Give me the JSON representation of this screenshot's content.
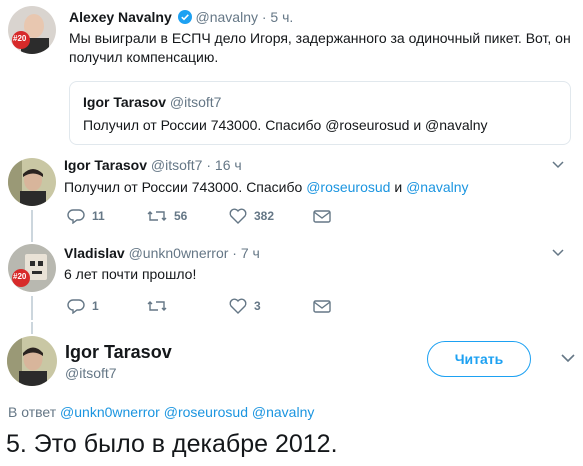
{
  "tweet1": {
    "name": "Alexey Navalny",
    "handle": "@navalny",
    "time": "· 5 ч.",
    "text": "Мы выиграли в ЕСПЧ дело Игоря, задержанного за одиночный пикет. Вот, он получил компенсацию.",
    "avatar_badge": "#20",
    "quote": {
      "name": "Igor Tarasov",
      "handle": "@itsoft7",
      "text": "Получил от России 743000. Спасибо @roseurosud и @navalny"
    }
  },
  "tweet2": {
    "name": "Igor Tarasov",
    "handle": "@itsoft7",
    "time": "· 16 ч",
    "text_prefix": "Получил от России 743000. Спасибо ",
    "mention1": "@roseurosud",
    "text_mid": " и ",
    "mention2": "@navalny",
    "replies": "11",
    "retweets": "56",
    "likes": "382"
  },
  "tweet3": {
    "name": "Vladislav",
    "handle": "@unkn0wnerror",
    "time": "· 7 ч",
    "text": "6 лет почти прошло!",
    "avatar_badge": "#20",
    "replies": "1",
    "likes": "3"
  },
  "main": {
    "name": "Igor Tarasov",
    "handle": "@itsoft7",
    "follow_label": "Читать",
    "reply_to_prefix": "В ответ",
    "reply_to_mentions": [
      "@unkn0wnerror",
      "@roseurosud",
      "@navalny"
    ]
  },
  "caption": "5. Это было в декабре 2012.",
  "colors": {
    "link": "#1b95e0",
    "verified": "#1da1f2",
    "muted": "#657786",
    "border": "#e1e8ed"
  },
  "icons": [
    "verified-badge-icon",
    "chevron-down-icon",
    "reply-icon",
    "retweet-icon",
    "like-icon",
    "direct-message-icon"
  ]
}
